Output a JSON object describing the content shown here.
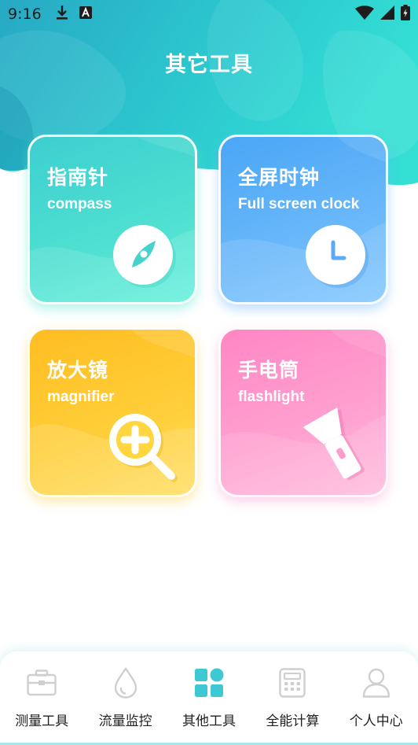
{
  "status_bar": {
    "time": "9:16",
    "icons": [
      "download-icon",
      "app-a-icon",
      "wifi-icon",
      "signal-icon",
      "battery-charging-icon"
    ]
  },
  "header": {
    "title": "其它工具"
  },
  "cards": [
    {
      "title": "指南针",
      "subtitle": "compass",
      "icon": "compass-icon",
      "color": "#4fd8d4"
    },
    {
      "title": "全屏时钟",
      "subtitle": "Full screen clock",
      "icon": "clock-icon",
      "color": "#5db0f8"
    },
    {
      "title": "放大镜",
      "subtitle": "magnifier",
      "icon": "magnifier-icon",
      "color": "#ffc833"
    },
    {
      "title": "手电筒",
      "subtitle": "flashlight",
      "icon": "flashlight-icon",
      "color": "#ff96c9"
    }
  ],
  "bottom_nav": {
    "active_index": 2,
    "active_color": "#3ec9d2",
    "items": [
      {
        "label": "测量工具",
        "icon": "toolbox-icon"
      },
      {
        "label": "流量监控",
        "icon": "droplet-icon"
      },
      {
        "label": "其他工具",
        "icon": "grid-tiles-icon"
      },
      {
        "label": "全能计算",
        "icon": "calculator-icon"
      },
      {
        "label": "个人中心",
        "icon": "person-icon"
      }
    ]
  }
}
